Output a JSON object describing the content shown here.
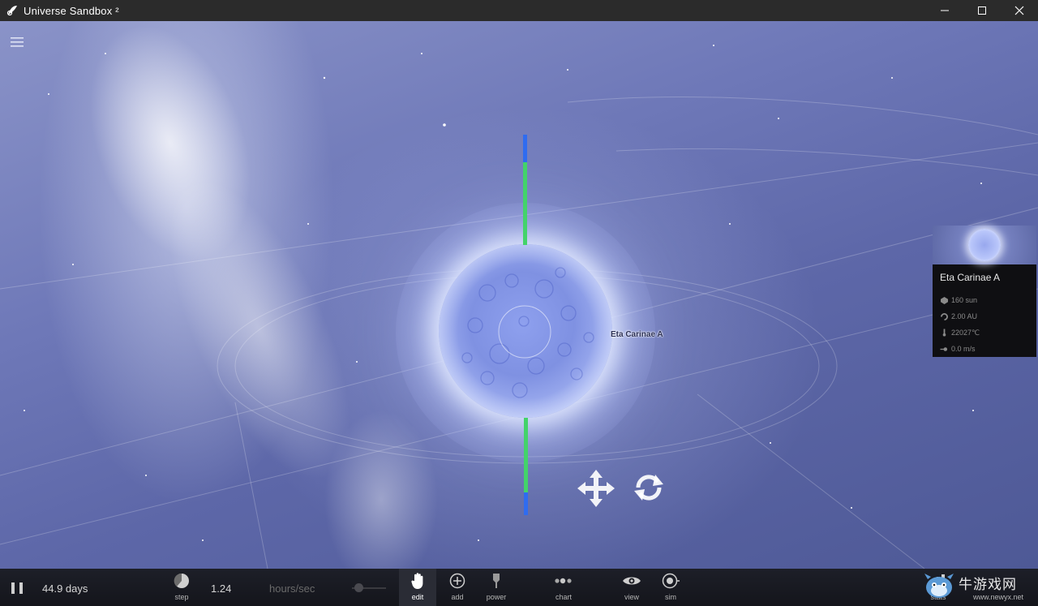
{
  "window": {
    "title": "Universe Sandbox ²",
    "controls": {
      "minimize_icon": "minimize-icon",
      "maximize_icon": "maximize-icon",
      "close_icon": "close-icon"
    }
  },
  "viewport": {
    "menu_icon": "hamburger-menu-icon",
    "selected_body_label": "Eta Carinae A",
    "gizmo_icons": [
      "move-arrows-icon",
      "rotate-icon"
    ]
  },
  "info_card": {
    "name": "Eta Carinae A",
    "rows": [
      {
        "icon": "mass-icon",
        "value": "160 sun"
      },
      {
        "icon": "orbit-icon",
        "value": "2.00 AU"
      },
      {
        "icon": "thermometer-icon",
        "value": "22027℃"
      },
      {
        "icon": "velocity-icon",
        "value": "0.0 m/s"
      }
    ]
  },
  "toolbar": {
    "pause_icon": "pause-icon",
    "elapsed_time": "44.9 days",
    "step_label": "step",
    "speed_value": "1.24",
    "speed_unit": "hours/sec",
    "tools": [
      {
        "label": "edit",
        "icon": "hand-icon",
        "active": true
      },
      {
        "label": "add",
        "icon": "plus-circle-icon",
        "active": false
      },
      {
        "label": "power",
        "icon": "power-icon",
        "active": false
      },
      {
        "label": "chart",
        "icon": "chart-dots-icon",
        "active": false
      },
      {
        "label": "view",
        "icon": "eye-icon",
        "active": false
      },
      {
        "label": "sim",
        "icon": "sim-target-icon",
        "active": false
      }
    ],
    "stats_label": "stats",
    "watermark_text": "牛游戏网",
    "watermark_url": "www.newyx.net"
  },
  "colors": {
    "titlebar": "#2b2b2b",
    "toolbar": "#17181e",
    "axis_blue": "#2f6cf0",
    "axis_green": "#43d36a",
    "sky": "#6e78b8"
  }
}
